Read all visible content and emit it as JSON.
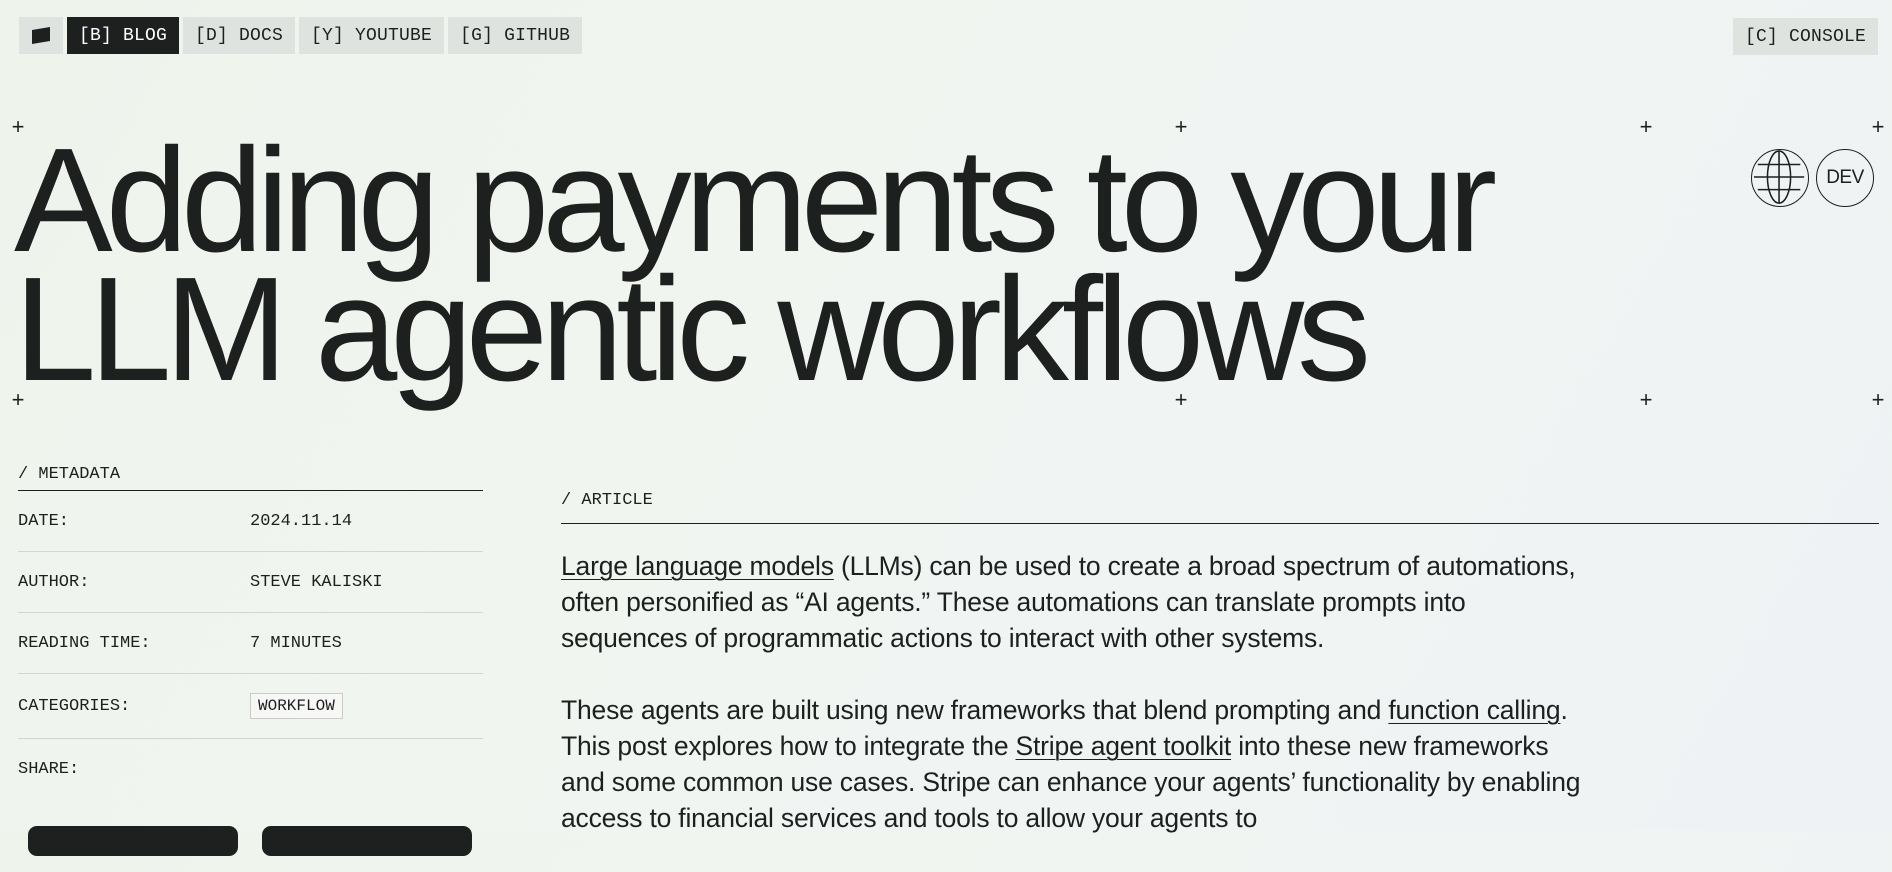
{
  "nav": {
    "logo_icon": "flag-icon",
    "items": [
      {
        "label": "[B] BLOG",
        "active": true
      },
      {
        "label": "[D] DOCS",
        "active": false
      },
      {
        "label": "[Y] YOUTUBE",
        "active": false
      },
      {
        "label": "[G] GITHUB",
        "active": false
      }
    ],
    "console_label": "[C] CONSOLE"
  },
  "hero": {
    "title_line1": "Adding payments to your",
    "title_line2": "LLM agentic workflows",
    "globe_icon": "globe-icon",
    "dev_badge": "DEV"
  },
  "metadata": {
    "heading": "/ METADATA",
    "rows": [
      {
        "key": "DATE:",
        "value": "2024.11.14"
      },
      {
        "key": "AUTHOR:",
        "value": "STEVE KALISKI"
      },
      {
        "key": "READING TIME:",
        "value": "7 MINUTES"
      },
      {
        "key": "CATEGORIES:",
        "value": "WORKFLOW"
      },
      {
        "key": "SHARE:",
        "value": ""
      }
    ]
  },
  "article": {
    "heading": "/ ARTICLE",
    "p1": {
      "link1": "Large language models",
      "text1": " (LLMs) can be used to create a broad spectrum of automations, often personified as “AI agents.” These automations can translate prompts into sequences of programmatic actions to interact with other systems."
    },
    "p2": {
      "text1": "These agents are built using new frameworks that blend prompting and ",
      "link1": "function calling",
      "text2": ". This post explores how to integrate the ",
      "link2": "Stripe agent toolkit",
      "text3": " into these new frameworks and some common use cases. Stripe can enhance your agents’ functionality by enabling access to financial services and tools to allow your agents to"
    }
  },
  "colors": {
    "ink": "#1e1f1f",
    "nav_bg": "#dfe3df",
    "page_bg": "#eef4ec"
  }
}
